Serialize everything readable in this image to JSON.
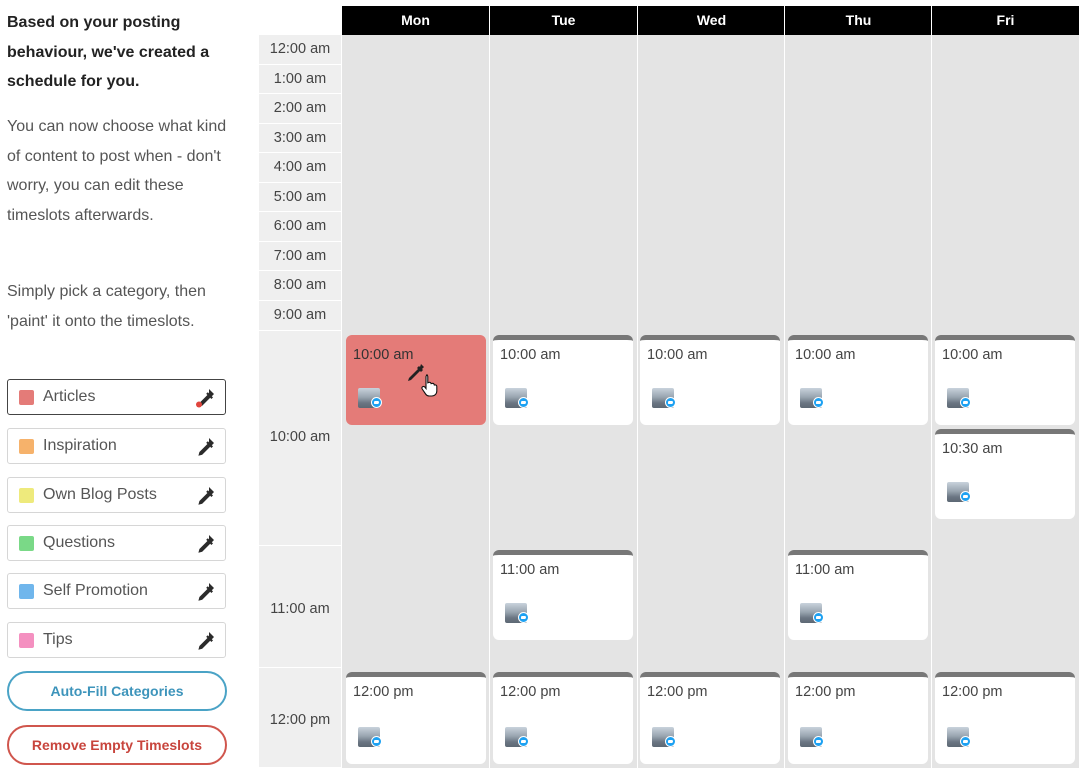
{
  "sidebar": {
    "intro_title": "Based on your posting behaviour, we've created a schedule for you.",
    "intro_text_1": "You can now choose what kind of content to post when - don't worry, you can edit these timeslots afterwards.",
    "intro_text_2": "Simply pick a category, then 'paint' it onto the timeslots.",
    "categories": [
      {
        "label": "Articles",
        "color": "#e47b78",
        "icon": "eyedropper-icon",
        "active": true
      },
      {
        "label": "Inspiration",
        "color": "#f6b26b",
        "icon": "eyedropper-icon"
      },
      {
        "label": "Own Blog Posts",
        "color": "#eeea7c",
        "icon": "eyedropper-icon"
      },
      {
        "label": "Questions",
        "color": "#7ad987",
        "icon": "eyedropper-icon"
      },
      {
        "label": "Self Promotion",
        "color": "#70b6ec",
        "icon": "eyedropper-icon"
      },
      {
        "label": "Tips",
        "color": "#f490c0",
        "icon": "eyedropper-icon"
      }
    ],
    "autofill_label": "Auto-Fill Categories",
    "remove_label": "Remove Empty Timeslots"
  },
  "calendar": {
    "days": [
      "Mon",
      "Tue",
      "Wed",
      "Thu",
      "Fri"
    ],
    "hours": [
      "12:00 am",
      "1:00 am",
      "2:00 am",
      "3:00 am",
      "4:00 am",
      "5:00 am",
      "6:00 am",
      "7:00 am",
      "8:00 am",
      "9:00 am",
      "10:00 am",
      "11:00 am",
      "12:00 pm"
    ],
    "slots": [
      {
        "day": "Mon",
        "time": "10:00 am",
        "category": "Articles",
        "network": "twitter"
      },
      {
        "day": "Tue",
        "time": "10:00 am",
        "network": "twitter"
      },
      {
        "day": "Wed",
        "time": "10:00 am",
        "network": "twitter"
      },
      {
        "day": "Thu",
        "time": "10:00 am",
        "network": "twitter"
      },
      {
        "day": "Fri",
        "time": "10:00 am",
        "network": "twitter"
      },
      {
        "day": "Fri",
        "time": "10:30 am",
        "network": "twitter"
      },
      {
        "day": "Tue",
        "time": "11:00 am",
        "network": "twitter"
      },
      {
        "day": "Thu",
        "time": "11:00 am",
        "network": "twitter"
      },
      {
        "day": "Mon",
        "time": "12:00 pm",
        "network": "twitter"
      },
      {
        "day": "Tue",
        "time": "12:00 pm",
        "network": "twitter"
      },
      {
        "day": "Wed",
        "time": "12:00 pm",
        "network": "twitter"
      },
      {
        "day": "Thu",
        "time": "12:00 pm",
        "network": "twitter"
      },
      {
        "day": "Fri",
        "time": "12:00 pm",
        "network": "twitter"
      }
    ],
    "cursor": "eyedropper-icon"
  }
}
